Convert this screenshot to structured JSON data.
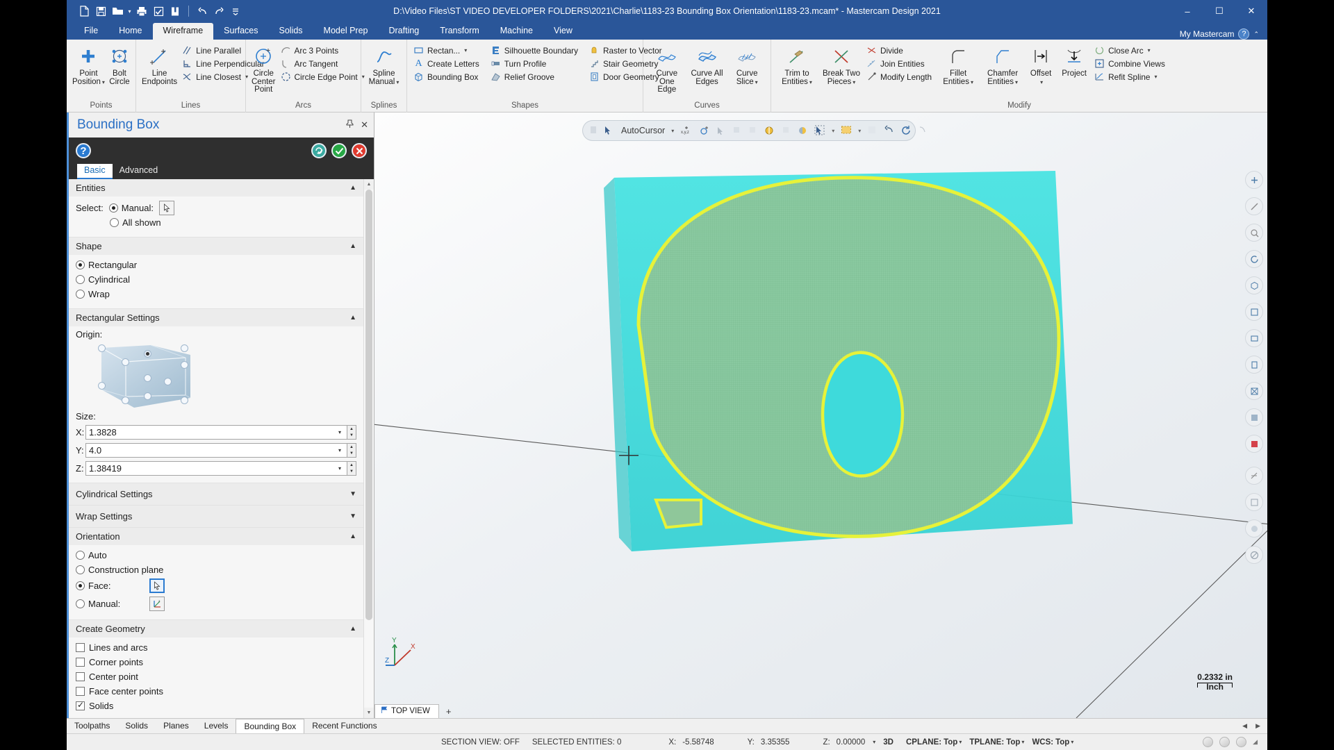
{
  "titlebar": {
    "document_title": "D:\\Video Files\\ST VIDEO DEVELOPER FOLDERS\\2021\\Charlie\\1183-23 Bounding Box Orientation\\1183-23.mcam* - Mastercam Design 2021",
    "quick_access": [
      {
        "name": "new-file-icon",
        "tip": "New"
      },
      {
        "name": "save-icon",
        "tip": "Save"
      },
      {
        "name": "open-folder-icon",
        "tip": "Open"
      },
      {
        "name": "print-icon",
        "tip": "Print"
      },
      {
        "name": "print-preview-icon",
        "tip": "Print Preview"
      },
      {
        "name": "zip2go-icon",
        "tip": "Zip2Go"
      },
      {
        "name": "undo-icon",
        "tip": "Undo"
      },
      {
        "name": "redo-icon",
        "tip": "Redo"
      },
      {
        "name": "customize-qat-icon",
        "tip": "Customize"
      }
    ],
    "window_buttons": {
      "minimize": "–",
      "maximize": "☐",
      "close": "✕"
    }
  },
  "ribbon": {
    "tabs": [
      "File",
      "Home",
      "Wireframe",
      "Surfaces",
      "Solids",
      "Model Prep",
      "Drafting",
      "Transform",
      "Machine",
      "View"
    ],
    "active_tab": "Wireframe",
    "account_label": "My Mastercam",
    "groups": [
      {
        "label": "Points",
        "big": [
          {
            "label": "Point\nPosition",
            "icon": "point-position-icon",
            "dropdown": true
          },
          {
            "label": "Bolt\nCircle",
            "icon": "bolt-circle-icon",
            "dropdown": false
          }
        ],
        "small": []
      },
      {
        "label": "Lines",
        "big": [
          {
            "label": "Line\nEndpoints",
            "icon": "line-endpoints-icon",
            "dropdown": false
          }
        ],
        "small": [
          {
            "label": "Line Parallel",
            "icon": "line-parallel-icon",
            "dropdown": false
          },
          {
            "label": "Line Perpendicular",
            "icon": "line-perpendicular-icon",
            "dropdown": false
          },
          {
            "label": "Line Closest",
            "icon": "line-closest-icon",
            "dropdown": true
          }
        ]
      },
      {
        "label": "Arcs",
        "big": [
          {
            "label": "Circle\nCenter Point",
            "icon": "circle-center-point-icon",
            "dropdown": false
          }
        ],
        "small": [
          {
            "label": "Arc 3 Points",
            "icon": "arc-3-points-icon",
            "dropdown": false
          },
          {
            "label": "Arc Tangent",
            "icon": "arc-tangent-icon",
            "dropdown": false
          },
          {
            "label": "Circle Edge Point",
            "icon": "circle-edge-point-icon",
            "dropdown": true
          }
        ]
      },
      {
        "label": "Splines",
        "big": [
          {
            "label": "Spline\nManual",
            "icon": "spline-manual-icon",
            "dropdown": true
          }
        ],
        "small": []
      },
      {
        "label": "Shapes",
        "big": [],
        "small": [
          {
            "label": "Rectan...",
            "icon": "rectangle-icon",
            "dropdown": true
          },
          {
            "label": "Create Letters",
            "icon": "create-letters-icon",
            "dropdown": false
          },
          {
            "label": "Bounding Box",
            "icon": "bounding-box-icon",
            "dropdown": false
          },
          {
            "label": "Silhouette Boundary",
            "icon": "silhouette-boundary-icon",
            "dropdown": false
          },
          {
            "label": "Turn Profile",
            "icon": "turn-profile-icon",
            "dropdown": false
          },
          {
            "label": "Relief Groove",
            "icon": "relief-groove-icon",
            "dropdown": false
          },
          {
            "label": "Raster to Vector",
            "icon": "raster-to-vector-icon",
            "dropdown": false
          },
          {
            "label": "Stair Geometry",
            "icon": "stair-geometry-icon",
            "dropdown": false
          },
          {
            "label": "Door Geometry",
            "icon": "door-geometry-icon",
            "dropdown": false
          }
        ]
      },
      {
        "label": "Curves",
        "big": [
          {
            "label": "Curve\nOne Edge",
            "icon": "curve-one-edge-icon",
            "dropdown": false
          },
          {
            "label": "Curve All\nEdges",
            "icon": "curve-all-edges-icon",
            "dropdown": false
          },
          {
            "label": "Curve\nSlice",
            "icon": "curve-slice-icon",
            "dropdown": true
          }
        ],
        "small": []
      },
      {
        "label": "Modify",
        "big": [
          {
            "label": "Trim to\nEntities",
            "icon": "trim-to-entities-icon",
            "dropdown": true
          },
          {
            "label": "Break Two\nPieces",
            "icon": "break-two-pieces-icon",
            "dropdown": true
          },
          {
            "label": "Fillet\nEntities",
            "icon": "fillet-entities-icon",
            "dropdown": true
          },
          {
            "label": "Chamfer\nEntities",
            "icon": "chamfer-entities-icon",
            "dropdown": true
          },
          {
            "label": "Offset",
            "icon": "offset-icon",
            "dropdown": true
          },
          {
            "label": "Project",
            "icon": "project-icon",
            "dropdown": false
          }
        ],
        "small": [
          {
            "label": "Divide",
            "icon": "divide-icon",
            "dropdown": false
          },
          {
            "label": "Join Entities",
            "icon": "join-entities-icon",
            "dropdown": false
          },
          {
            "label": "Modify Length",
            "icon": "modify-length-icon",
            "dropdown": false
          },
          {
            "label": "Close Arc",
            "icon": "close-arc-icon",
            "dropdown": true
          },
          {
            "label": "Combine Views",
            "icon": "combine-views-icon",
            "dropdown": false
          },
          {
            "label": "Refit Spline",
            "icon": "refit-spline-icon",
            "dropdown": true
          }
        ]
      }
    ]
  },
  "panel": {
    "title": "Bounding Box",
    "pin_icon": "pin-icon",
    "close_icon": "close-icon",
    "help_icon": "help-icon",
    "action_buttons": [
      {
        "name": "apply-and-create-new-operation-button",
        "glyph": "↺✓",
        "color": "#3aa9a0"
      },
      {
        "name": "ok-button",
        "glyph": "✓",
        "color": "#27a845"
      },
      {
        "name": "cancel-button",
        "glyph": "✕",
        "color": "#e03b2f"
      }
    ],
    "tabs": [
      {
        "label": "Basic",
        "active": true
      },
      {
        "label": "Advanced",
        "active": false
      }
    ],
    "sections": [
      {
        "id": "entities",
        "title": "Entities",
        "expanded": true,
        "select_label": "Select:",
        "options": [
          {
            "label": "Manual:",
            "selected": true,
            "has_picker": true
          },
          {
            "label": "All shown",
            "selected": false,
            "has_picker": false
          }
        ]
      },
      {
        "id": "shape",
        "title": "Shape",
        "expanded": true,
        "options": [
          {
            "label": "Rectangular",
            "selected": true
          },
          {
            "label": "Cylindrical",
            "selected": false
          },
          {
            "label": "Wrap",
            "selected": false
          }
        ]
      },
      {
        "id": "rect-settings",
        "title": "Rectangular Settings",
        "expanded": true,
        "origin_label": "Origin:",
        "origin_selected_node": "top-center",
        "size_label": "Size:",
        "size": [
          {
            "axis": "X:",
            "value": "1.3828"
          },
          {
            "axis": "Y:",
            "value": "4.0"
          },
          {
            "axis": "Z:",
            "value": "1.38419"
          }
        ]
      },
      {
        "id": "cyl-settings",
        "title": "Cylindrical Settings",
        "expanded": false
      },
      {
        "id": "wrap-settings",
        "title": "Wrap Settings",
        "expanded": false
      },
      {
        "id": "orientation",
        "title": "Orientation",
        "expanded": true,
        "options": [
          {
            "label": "Auto",
            "selected": false,
            "has_picker": false
          },
          {
            "label": "Construction plane",
            "selected": false,
            "has_picker": false
          },
          {
            "label": "Face:",
            "selected": true,
            "has_picker": true,
            "picker_icon": "cursor-arrow-icon",
            "picker_active": true
          },
          {
            "label": "Manual:",
            "selected": false,
            "has_picker": true,
            "picker_icon": "axis-gizmo-icon",
            "picker_active": false
          }
        ]
      },
      {
        "id": "create-geometry",
        "title": "Create Geometry",
        "expanded": true,
        "checkboxes": [
          {
            "label": "Lines and arcs",
            "checked": false
          },
          {
            "label": "Corner points",
            "checked": false
          },
          {
            "label": "Center point",
            "checked": false
          },
          {
            "label": "Face center points",
            "checked": false
          },
          {
            "label": "Solids",
            "checked": true
          }
        ]
      }
    ]
  },
  "viewport": {
    "autocursor_label": "AutoCursor",
    "view_tab": "TOP VIEW",
    "view_tab_icon": "view-flag-icon",
    "add_view_tab": "+",
    "scale_value": "0.2332 in",
    "scale_unit": "Inch",
    "axis_labels": {
      "x": "X",
      "y": "Y",
      "z": "Z"
    },
    "colors": {
      "box_face": "#3edadb",
      "model_fill": "#8fc79a",
      "model_edge": "#e6f23a",
      "background_top": "#fdfdfd",
      "background_bottom": "#e2e7ec"
    },
    "right_toolbar_icons": [
      "fit-icon",
      "unzoom-icon",
      "zoom-window-icon",
      "dynamic-rotate-icon",
      "isometric-view-icon",
      "top-view-icon",
      "front-view-icon",
      "right-view-icon",
      "wireframe-shading-icon",
      "shaded-icon",
      "translucency-icon",
      "section-view-icon",
      "blank-icon",
      "appearance-icon",
      "no-entry-icon"
    ]
  },
  "bottom_tabs": {
    "tabs": [
      {
        "label": "Toolpaths",
        "active": false
      },
      {
        "label": "Solids",
        "active": false
      },
      {
        "label": "Planes",
        "active": false
      },
      {
        "label": "Levels",
        "active": false
      },
      {
        "label": "Bounding Box",
        "active": true
      },
      {
        "label": "Recent Functions",
        "active": false
      }
    ],
    "nav_left": "◀",
    "nav_right": "▶"
  },
  "statusbar": {
    "section_view": "SECTION VIEW: OFF",
    "selected_entities": "SELECTED ENTITIES: 0",
    "coords": [
      {
        "axis": "X:",
        "value": "-5.58748"
      },
      {
        "axis": "Y:",
        "value": "3.35355"
      },
      {
        "axis": "Z:",
        "value": "0.00000"
      }
    ],
    "mode": "3D",
    "planes": [
      {
        "label": "CPLANE:",
        "value": "Top"
      },
      {
        "label": "TPLANE:",
        "value": "Top"
      },
      {
        "label": "WCS:",
        "value": "Top"
      }
    ]
  }
}
